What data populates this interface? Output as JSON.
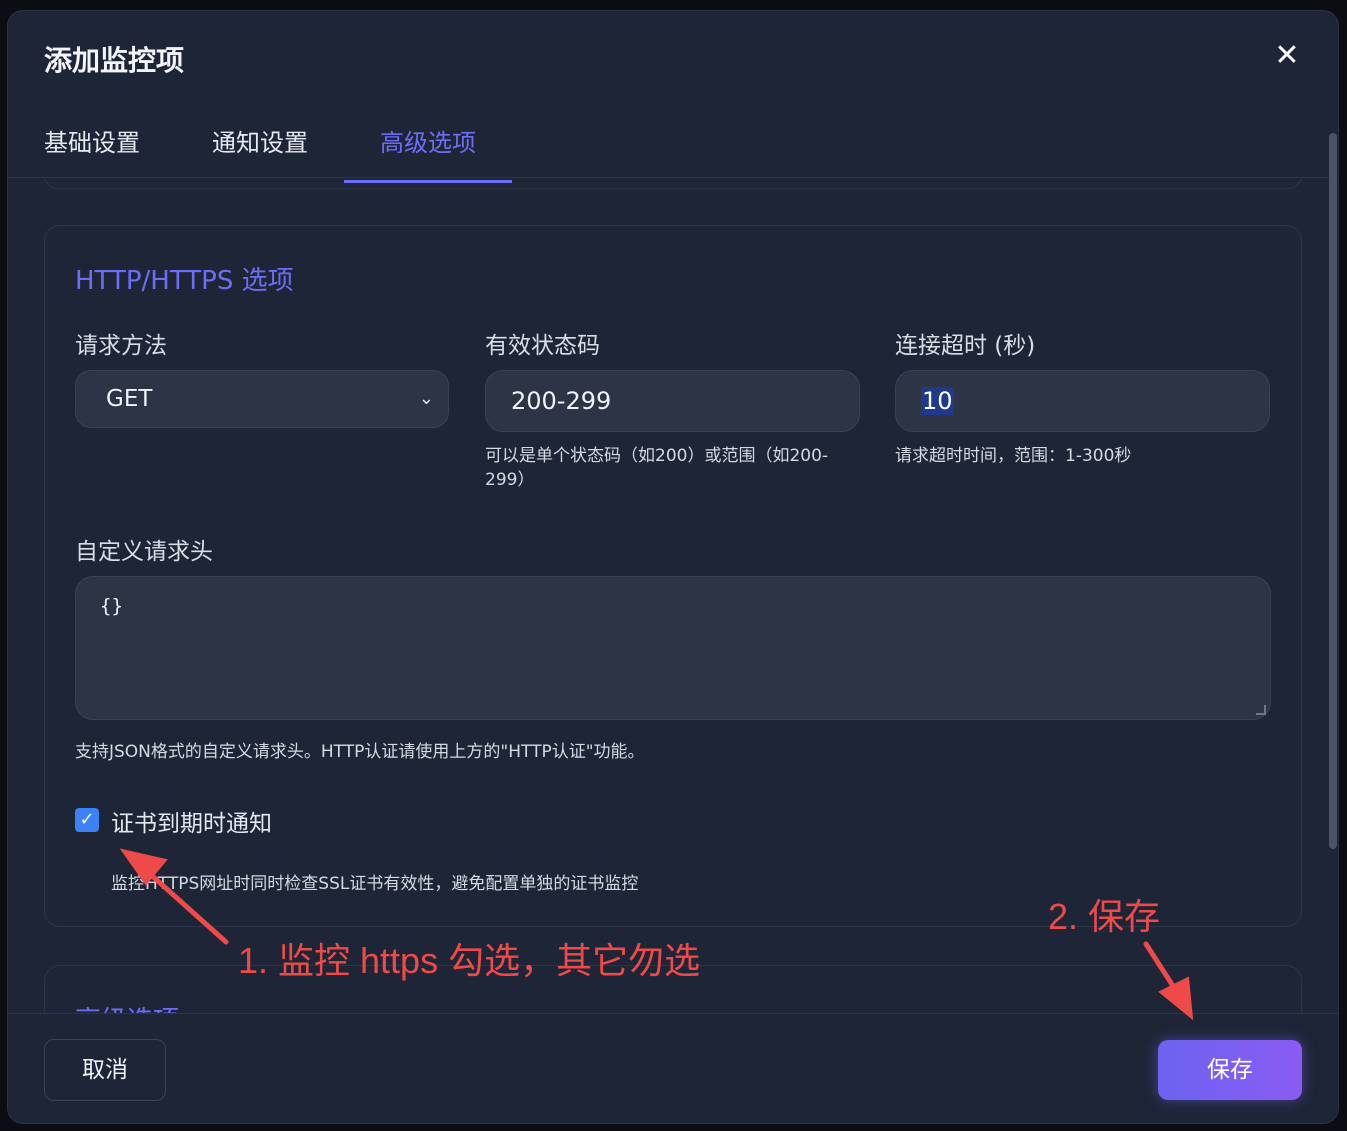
{
  "modal": {
    "title": "添加监控项",
    "close_label": "✕"
  },
  "tabs": [
    {
      "label": "基础设置"
    },
    {
      "label": "通知设置"
    },
    {
      "label": "高级选项"
    }
  ],
  "http_section": {
    "title": "HTTP/HTTPS 选项",
    "method": {
      "label": "请求方法",
      "value": "GET",
      "chevron": "⌄"
    },
    "status_codes": {
      "label": "有效状态码",
      "value": "200-299",
      "hint": "可以是单个状态码（如200）或范围（如200-299）"
    },
    "timeout": {
      "label": "连接超时 (秒)",
      "value": "10",
      "hint": "请求超时时间，范围：1-300秒"
    },
    "headers": {
      "label": "自定义请求头",
      "value": "{}",
      "hint": "支持JSON格式的自定义请求头。HTTP认证请使用上方的\"HTTP认证\"功能。"
    },
    "cert_notify": {
      "label": "证书到期时通知",
      "checked": true,
      "check": "✓",
      "hint": "监控HTTPS网址时同时检查SSL证书有效性，避免配置单独的证书监控"
    }
  },
  "advanced_section": {
    "title": "高级选项"
  },
  "footer": {
    "cancel_label": "取消",
    "save_label": "保存"
  },
  "annotations": {
    "step1": "1. 监控 https 勾选，其它勿选",
    "step2": "2. 保存",
    "color": "#ef4a4a"
  },
  "colors": {
    "accent": "#6d6ef7",
    "background": "#1e2536",
    "input": "#2d3446"
  }
}
